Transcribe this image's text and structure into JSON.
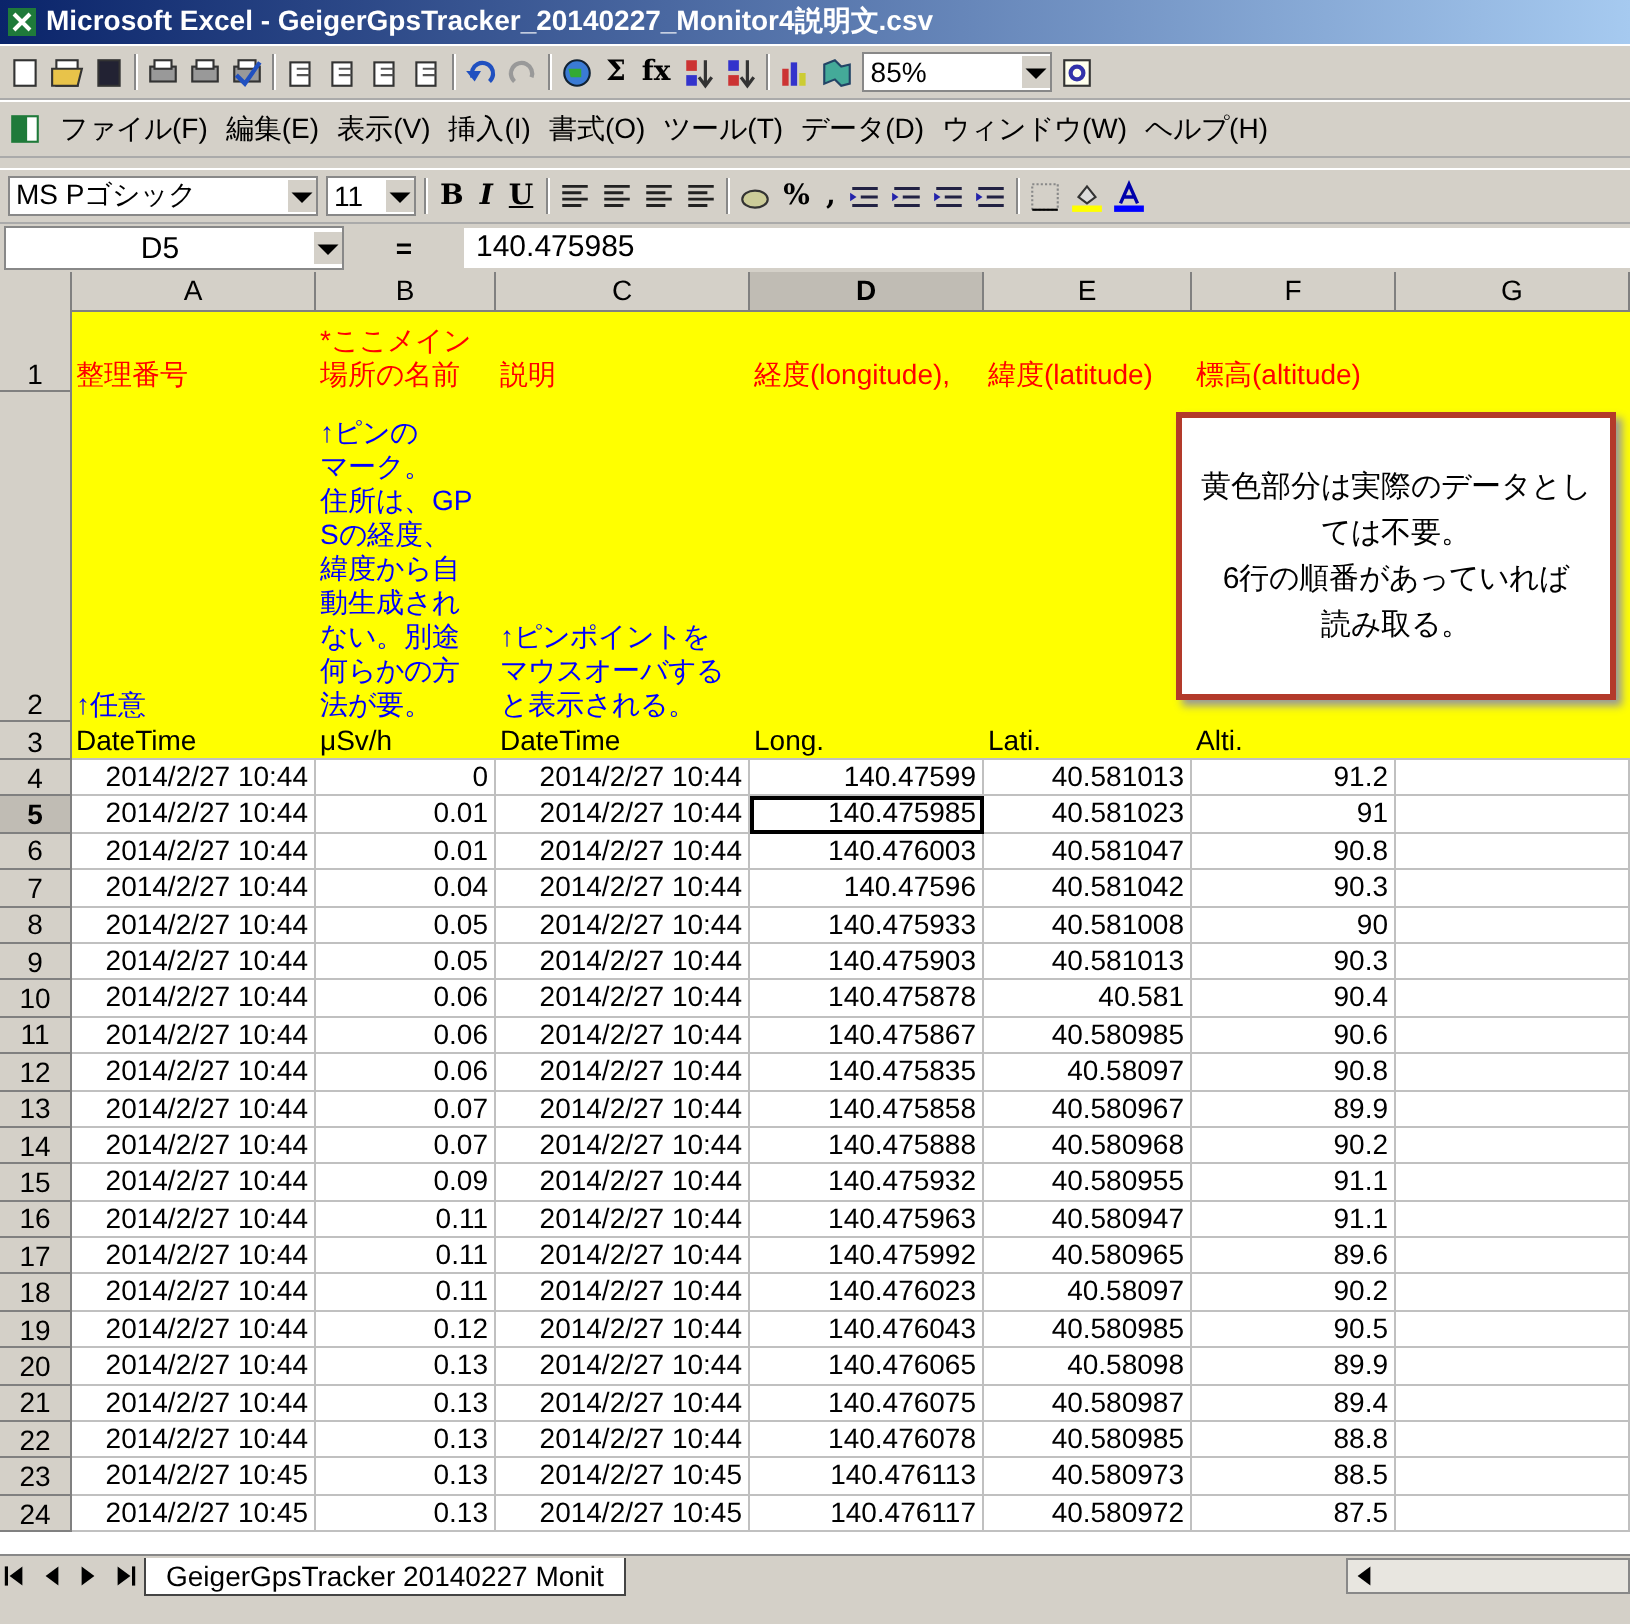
{
  "window": {
    "title": "Microsoft Excel - GeigerGpsTracker_20140227_Monitor4説明文.csv"
  },
  "toolbar": {
    "glyphs": [
      "Σ",
      "fx"
    ],
    "zoom": "85%"
  },
  "menu": [
    "ファイル(F)",
    "編集(E)",
    "表示(V)",
    "挿入(I)",
    "書式(O)",
    "ツール(T)",
    "データ(D)",
    "ウィンドウ(W)",
    "ヘルプ(H)"
  ],
  "format_toolbar": {
    "font": "MS Pゴシック",
    "size": "11",
    "style_buttons": [
      "B",
      "I",
      "U"
    ],
    "percent": "%",
    "comma": ","
  },
  "formula_bar": {
    "name_box": "D5",
    "equals": "=",
    "value": "140.475985"
  },
  "columns": [
    {
      "label": "A",
      "selected": false
    },
    {
      "label": "B",
      "selected": false
    },
    {
      "label": "C",
      "selected": false
    },
    {
      "label": "D",
      "selected": true
    },
    {
      "label": "E",
      "selected": false
    },
    {
      "label": "F",
      "selected": false
    },
    {
      "label": "G",
      "selected": false
    }
  ],
  "header_rows": [
    {
      "number": "1",
      "kind": "title",
      "cells": [
        [
          "整理番号"
        ],
        [
          "*ここメイン",
          "場所の名前"
        ],
        [
          "説明"
        ],
        [
          "経度(longitude),"
        ],
        [
          "緯度(latitude)"
        ],
        [
          "標高(altitude)"
        ]
      ]
    },
    {
      "number": "2",
      "kind": "note",
      "cells": [
        [
          "↑任意"
        ],
        [
          "↑ピンの",
          "マーク。",
          "住所は、GP",
          "Sの経度、",
          "緯度から自",
          "動生成され",
          "ない。別途",
          "何らかの方",
          "法が要。"
        ],
        [
          "↑ピンポイントを",
          "マウスオーバする",
          "と表示される。"
        ],
        [],
        [],
        []
      ]
    },
    {
      "number": "3",
      "kind": "label",
      "cells": [
        [
          "DateTime"
        ],
        [
          "μSv/h"
        ],
        [
          "DateTime"
        ],
        [
          "Long."
        ],
        [
          "Lati."
        ],
        [
          "Alti."
        ]
      ]
    }
  ],
  "rows": [
    {
      "number": "4",
      "selected": false,
      "cells": [
        "2014/2/27 10:44",
        "0",
        "2014/2/27 10:44",
        "140.47599",
        "40.581013",
        "91.2"
      ]
    },
    {
      "number": "5",
      "selected": true,
      "cells": [
        "2014/2/27 10:44",
        "0.01",
        "2014/2/27 10:44",
        "140.475985",
        "40.581023",
        "91"
      ]
    },
    {
      "number": "6",
      "selected": false,
      "cells": [
        "2014/2/27 10:44",
        "0.01",
        "2014/2/27 10:44",
        "140.476003",
        "40.581047",
        "90.8"
      ]
    },
    {
      "number": "7",
      "selected": false,
      "cells": [
        "2014/2/27 10:44",
        "0.04",
        "2014/2/27 10:44",
        "140.47596",
        "40.581042",
        "90.3"
      ]
    },
    {
      "number": "8",
      "selected": false,
      "cells": [
        "2014/2/27 10:44",
        "0.05",
        "2014/2/27 10:44",
        "140.475933",
        "40.581008",
        "90"
      ]
    },
    {
      "number": "9",
      "selected": false,
      "cells": [
        "2014/2/27 10:44",
        "0.05",
        "2014/2/27 10:44",
        "140.475903",
        "40.581013",
        "90.3"
      ]
    },
    {
      "number": "10",
      "selected": false,
      "cells": [
        "2014/2/27 10:44",
        "0.06",
        "2014/2/27 10:44",
        "140.475878",
        "40.581",
        "90.4"
      ]
    },
    {
      "number": "11",
      "selected": false,
      "cells": [
        "2014/2/27 10:44",
        "0.06",
        "2014/2/27 10:44",
        "140.475867",
        "40.580985",
        "90.6"
      ]
    },
    {
      "number": "12",
      "selected": false,
      "cells": [
        "2014/2/27 10:44",
        "0.06",
        "2014/2/27 10:44",
        "140.475835",
        "40.58097",
        "90.8"
      ]
    },
    {
      "number": "13",
      "selected": false,
      "cells": [
        "2014/2/27 10:44",
        "0.07",
        "2014/2/27 10:44",
        "140.475858",
        "40.580967",
        "89.9"
      ]
    },
    {
      "number": "14",
      "selected": false,
      "cells": [
        "2014/2/27 10:44",
        "0.07",
        "2014/2/27 10:44",
        "140.475888",
        "40.580968",
        "90.2"
      ]
    },
    {
      "number": "15",
      "selected": false,
      "cells": [
        "2014/2/27 10:44",
        "0.09",
        "2014/2/27 10:44",
        "140.475932",
        "40.580955",
        "91.1"
      ]
    },
    {
      "number": "16",
      "selected": false,
      "cells": [
        "2014/2/27 10:44",
        "0.11",
        "2014/2/27 10:44",
        "140.475963",
        "40.580947",
        "91.1"
      ]
    },
    {
      "number": "17",
      "selected": false,
      "cells": [
        "2014/2/27 10:44",
        "0.11",
        "2014/2/27 10:44",
        "140.475992",
        "40.580965",
        "89.6"
      ]
    },
    {
      "number": "18",
      "selected": false,
      "cells": [
        "2014/2/27 10:44",
        "0.11",
        "2014/2/27 10:44",
        "140.476023",
        "40.58097",
        "90.2"
      ]
    },
    {
      "number": "19",
      "selected": false,
      "cells": [
        "2014/2/27 10:44",
        "0.12",
        "2014/2/27 10:44",
        "140.476043",
        "40.580985",
        "90.5"
      ]
    },
    {
      "number": "20",
      "selected": false,
      "cells": [
        "2014/2/27 10:44",
        "0.13",
        "2014/2/27 10:44",
        "140.476065",
        "40.58098",
        "89.9"
      ]
    },
    {
      "number": "21",
      "selected": false,
      "cells": [
        "2014/2/27 10:44",
        "0.13",
        "2014/2/27 10:44",
        "140.476075",
        "40.580987",
        "89.4"
      ]
    },
    {
      "number": "22",
      "selected": false,
      "cells": [
        "2014/2/27 10:44",
        "0.13",
        "2014/2/27 10:44",
        "140.476078",
        "40.580985",
        "88.8"
      ]
    },
    {
      "number": "23",
      "selected": false,
      "cells": [
        "2014/2/27 10:45",
        "0.13",
        "2014/2/27 10:45",
        "140.476113",
        "40.580973",
        "88.5"
      ]
    },
    {
      "number": "24",
      "selected": false,
      "cells": [
        "2014/2/27 10:45",
        "0.13",
        "2014/2/27 10:45",
        "140.476117",
        "40.580972",
        "87.5"
      ]
    }
  ],
  "callout": {
    "lines": [
      "黄色部分は実際のデータとし",
      "ては不要。",
      "6行の順番があっていれば",
      "読み取る。"
    ]
  },
  "sheet_tabs": [
    {
      "label": "GeigerGpsTracker 20140227 Monit",
      "selected": true
    }
  ]
}
